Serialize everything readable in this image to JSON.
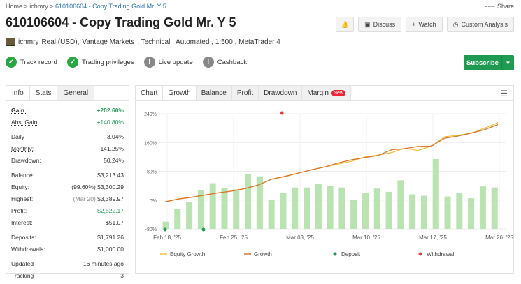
{
  "breadcrumb": {
    "home": "Home",
    "sep": " > ",
    "user": "ichmry",
    "current": "610106604 - Copy Trading Gold Mr. Y 5"
  },
  "share_label": "Share",
  "title": "610106604 - Copy Trading Gold Mr. Y 5",
  "actions": {
    "discuss": "Discuss",
    "watch": "Watch",
    "custom_analysis": "Custom Analysis"
  },
  "meta": {
    "user": "ichmry",
    "account": "Real (USD),",
    "broker": "Vantage Markets",
    "rest": ", Technical , Automated , 1:500 , MetaTrader 4"
  },
  "badges": [
    "Track record",
    "Trading privileges",
    "Live update",
    "Cashback"
  ],
  "subscribe_label": "Subscribe",
  "left_tabs": [
    "Info",
    "Stats",
    "General"
  ],
  "stats": {
    "gain_label": "Gain :",
    "gain": "+202.60%",
    "abs_gain_label": "Abs. Gain:",
    "abs_gain": "+140.80%",
    "daily_label": "Daily",
    "daily": "3.04%",
    "monthly_label": "Monthly:",
    "monthly": "141.25%",
    "drawdown_label": "Drawdown:",
    "drawdown": "50.24%",
    "balance_label": "Balance:",
    "balance": "$3,213.43",
    "equity_label": "Equity:",
    "equity_pct": "(99.60%)",
    "equity": "$3,300.29",
    "highest_label": "Highest:",
    "highest_date": "(Mar 20)",
    "highest": "$3,389.97",
    "profit_label": "Profit:",
    "profit": "$2,522.17",
    "interest_label": "Interest:",
    "interest": "$51.07",
    "deposits_label": "Deposits:",
    "deposits": "$1,791.26",
    "withdrawals_label": "Withdrawals:",
    "withdrawals": "$1,000.00",
    "updated_label": "Updated",
    "updated": "16 minutes ago",
    "tracking_label": "Tracking",
    "tracking": "3"
  },
  "right_tabs": [
    "Chart",
    "Growth",
    "Balance",
    "Profit",
    "Drawdown",
    "Margin"
  ],
  "new_tag": "New",
  "colors": {
    "accent": "#1e9a52",
    "bar": "#b9e3b0",
    "growth": "#d9742a",
    "equity": "#f0c040",
    "deposit": "#1e9a52",
    "withdrawal": "#d9433a"
  },
  "chart_data": {
    "type": "bar",
    "y_ticks": [
      "240%",
      "160%",
      "80%",
      "0%",
      "-80%"
    ],
    "ylim": [
      -80,
      240
    ],
    "x_ticks": [
      "Feb 18, '25",
      "Feb 25, '25",
      "Mar 03, '25",
      "Mar 10, '25",
      "Mar 17, '25",
      "Mar 26, '25"
    ],
    "bars": [
      -60,
      -25,
      -5,
      27,
      47,
      33,
      30,
      72,
      66,
      0,
      20,
      35,
      35,
      45,
      40,
      35,
      0,
      20,
      32,
      23,
      55,
      16,
      12,
      114,
      10,
      19,
      5,
      38,
      35
    ],
    "growth": [
      -5,
      3,
      8,
      14,
      20,
      25,
      32,
      42,
      58,
      66,
      75,
      84,
      92,
      103,
      112,
      118,
      124,
      140,
      143,
      149,
      150,
      172,
      178,
      186,
      196,
      210
    ],
    "equity": [
      -5,
      3,
      8,
      14,
      20,
      25,
      32,
      42,
      58,
      65,
      75,
      84,
      92,
      100,
      108,
      120,
      125,
      132,
      144,
      138,
      150,
      176,
      180,
      186,
      200,
      215
    ],
    "legend": [
      "Equity Growth",
      "Growth",
      "Deposit",
      "Withdrawal"
    ]
  }
}
